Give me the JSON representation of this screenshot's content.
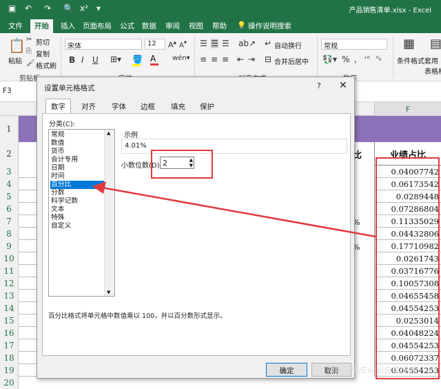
{
  "window": {
    "title": "产品销售清单.xlsx  -  Excel"
  },
  "quick_access": {
    "redo_icon": "redo-icon",
    "preview_icon": "print-preview-icon",
    "superscript": "x²"
  },
  "ribbon_tabs": [
    "文件",
    "开始",
    "插入",
    "页面布局",
    "公式",
    "数据",
    "审阅",
    "视图",
    "帮助",
    "操作说明搜索"
  ],
  "ribbon": {
    "paste": "粘贴",
    "cut": "剪切",
    "copy": "复制",
    "format_painter": "格式刷",
    "clipboard_group": "剪贴板",
    "font_name": "宋体",
    "font_size": "12",
    "bold": "B",
    "italic": "I",
    "underline": "U",
    "font_group": "字体",
    "wrap_text": "自动换行",
    "merge_center": "合并后居中",
    "alignment_group": "对齐方式",
    "number_format": "常规",
    "number_group": "数字",
    "conditional_format": "条件格式",
    "table_format": "套用\n表格格式"
  },
  "formula_bar": {
    "name_box": "F3"
  },
  "sheet": {
    "column_F_header": "F",
    "header_F": "业绩占比",
    "header_E_tail": "比",
    "percent_fragments": [
      "%",
      "%"
    ],
    "rows": [
      "1",
      "2",
      "3",
      "4",
      "5",
      "6",
      "7",
      "8",
      "9",
      "10",
      "11",
      "12",
      "13",
      "14",
      "15",
      "16",
      "17",
      "18",
      "19",
      "20"
    ],
    "values": [
      "0.04007742",
      "0.06173542",
      "0.0289448",
      "0.07286804",
      "0.11335029",
      "0.04432806",
      "0.17710982",
      "0.0261743",
      "0.03716776",
      "0.10057308",
      "0.04655458",
      "0.04554253",
      "0.0253014",
      "0.04048224",
      "0.04554253",
      "0.06072337",
      "0.04554253"
    ]
  },
  "dialog": {
    "title": "设置单元格格式",
    "help": "?",
    "close": "✕",
    "tabs": [
      "数字",
      "对齐",
      "字体",
      "边框",
      "填充",
      "保护"
    ],
    "category_label": "分类(C):",
    "categories": [
      "常规",
      "数值",
      "货币",
      "会计专用",
      "日期",
      "时间",
      "百分比",
      "分数",
      "科学记数",
      "文本",
      "特殊",
      "自定义"
    ],
    "selected_category": "百分比",
    "sample_label": "示例",
    "sample_value": "4.01%",
    "decimal_label": "小数位数(D):",
    "decimal_value": "2",
    "description": "百分比格式将单元格中数值乘以 100，并以百分数形式显示。",
    "ok": "确定",
    "cancel": "取消"
  },
  "watermark": "百家号/Excel自学成才",
  "colors": {
    "excel_green": "#217346",
    "highlight_red": "#e0393e",
    "selection_blue": "#0078d7",
    "header_purple": "#8e72b8"
  }
}
